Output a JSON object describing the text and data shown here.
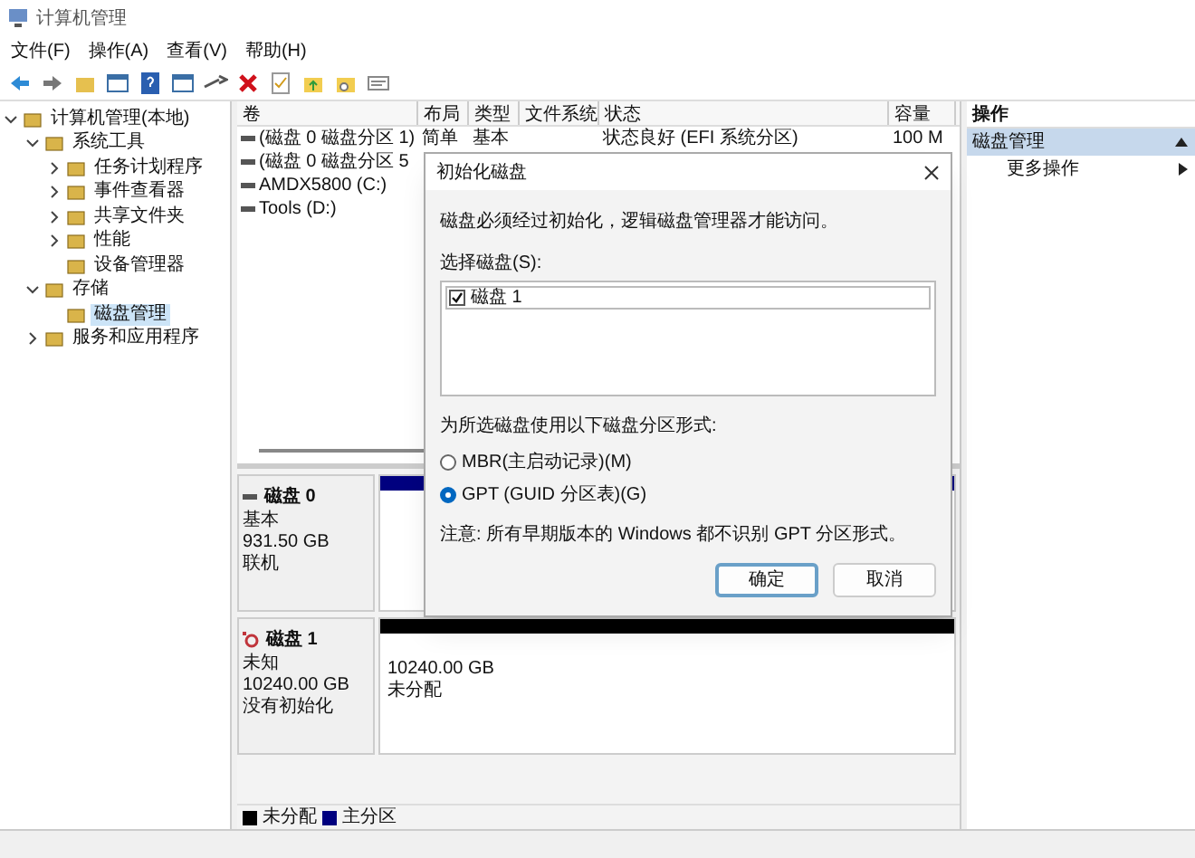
{
  "window": {
    "title": "计算机管理"
  },
  "menu": [
    "文件(F)",
    "操作(A)",
    "查看(V)",
    "帮助(H)"
  ],
  "tree": [
    {
      "label": "计算机管理(本地)",
      "selected": false,
      "expanded": true,
      "children": [
        {
          "label": "系统工具",
          "selected": false,
          "expanded": true,
          "children": [
            {
              "label": "任务计划程序",
              "selected": false,
              "expanded": false
            },
            {
              "label": "事件查看器",
              "selected": false,
              "expanded": false
            },
            {
              "label": "共享文件夹",
              "selected": false,
              "expanded": false
            },
            {
              "label": "性能",
              "selected": false,
              "expanded": false
            },
            {
              "label": "设备管理器",
              "selected": false
            }
          ]
        },
        {
          "label": "存储",
          "selected": false,
          "expanded": true,
          "children": [
            {
              "label": "磁盘管理",
              "selected": true
            }
          ]
        },
        {
          "label": "服务和应用程序",
          "selected": false,
          "expanded": false
        }
      ]
    }
  ],
  "volumes": {
    "columns": [
      "卷",
      "布局",
      "类型",
      "文件系统",
      "状态",
      "容量"
    ],
    "rows": [
      {
        "volume": "(磁盘 0 磁盘分区 1)",
        "layout": "简单",
        "type": "基本",
        "status": "状态良好 (EFI 系统分区)",
        "capacity": "100 M"
      },
      {
        "volume": "(磁盘 0 磁盘分区 5"
      },
      {
        "volume": "AMDX5800 (C:)"
      },
      {
        "volume": "Tools (D:)"
      }
    ]
  },
  "disks": [
    {
      "name": "磁盘 0",
      "kind": "online",
      "type": "基本",
      "size": "931.50 GB",
      "status": "联机",
      "partitions": [
        {
          "color": "#00007f"
        }
      ]
    },
    {
      "name": "磁盘 1",
      "kind": "uninitialized",
      "type": "未知",
      "size": "10240.00 GB",
      "status": "没有初始化",
      "partitions": [
        {
          "color": "#000000",
          "size": "10240.00 GB",
          "label": "未分配"
        }
      ]
    }
  ],
  "legend": [
    {
      "label": "未分配",
      "color": "#000000"
    },
    {
      "label": "主分区",
      "color": "#00007f"
    }
  ],
  "actions": {
    "title": "操作",
    "items": [
      {
        "label": "磁盘管理",
        "selected": true,
        "kind": "section"
      },
      {
        "label": "更多操作",
        "selected": false,
        "kind": "submenu"
      }
    ]
  },
  "dialog": {
    "title": "初始化磁盘",
    "message": "磁盘必须经过初始化，逻辑磁盘管理器才能访问。",
    "select_label": "选择磁盘(S):",
    "disks": [
      {
        "label": "磁盘 1",
        "checked": true
      }
    ],
    "style_label": "为所选磁盘使用以下磁盘分区形式:",
    "options": [
      {
        "label": "MBR(主启动记录)(M)",
        "selected": false
      },
      {
        "label": "GPT (GUID 分区表)(G)",
        "selected": true
      }
    ],
    "note": "注意: 所有早期版本的 Windows 都不识别 GPT 分区形式。",
    "buttons": [
      {
        "label": "确定",
        "kind": "default"
      },
      {
        "label": "取消",
        "kind": "normal"
      }
    ]
  }
}
